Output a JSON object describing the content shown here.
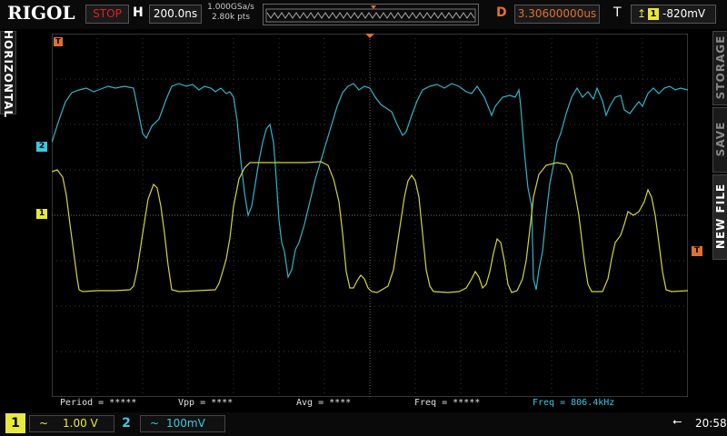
{
  "header": {
    "logo": "RIGOL",
    "run_state": "STOP",
    "horizontal_label": "H",
    "timebase": "200.0ns",
    "sample_rate": "1.000GSa/s",
    "memory_depth": "2.80k pts",
    "delay_label": "D",
    "delay": "3.30600000us",
    "trigger_label": "T",
    "trigger_source": "1",
    "trigger_level": "-820mV"
  },
  "side_tabs": {
    "left": "HORIZONTAL",
    "right_top": "STORAGE",
    "right_mid": "SAVE",
    "right_bottom": "NEW FILE"
  },
  "markers": {
    "ch1": "1",
    "ch2": "2",
    "trigger": "T"
  },
  "measurements": [
    {
      "label": "Period = *****",
      "color": "#e0e0e0"
    },
    {
      "label": "Vpp = ****",
      "color": "#e0e0e0"
    },
    {
      "label": "Avg = ****",
      "color": "#e0e0e0"
    },
    {
      "label": "Freq = *****",
      "color": "#e0e0e0"
    },
    {
      "label": "Freq = 806.4kHz",
      "color": "#3cc8e0"
    }
  ],
  "channels": [
    {
      "num": "1",
      "coupling": "~",
      "scale": "1.00 V",
      "color": "#e8e83c"
    },
    {
      "num": "2",
      "coupling": "~",
      "scale": "100mV",
      "color": "#3cc8e0"
    }
  ],
  "status": {
    "usb_icon": "usb-icon",
    "time": "20:58"
  },
  "colors": {
    "ch1": "#d4d43a",
    "ch2": "#30b4c8",
    "accent": "#e07030",
    "stop": "#e02020"
  }
}
